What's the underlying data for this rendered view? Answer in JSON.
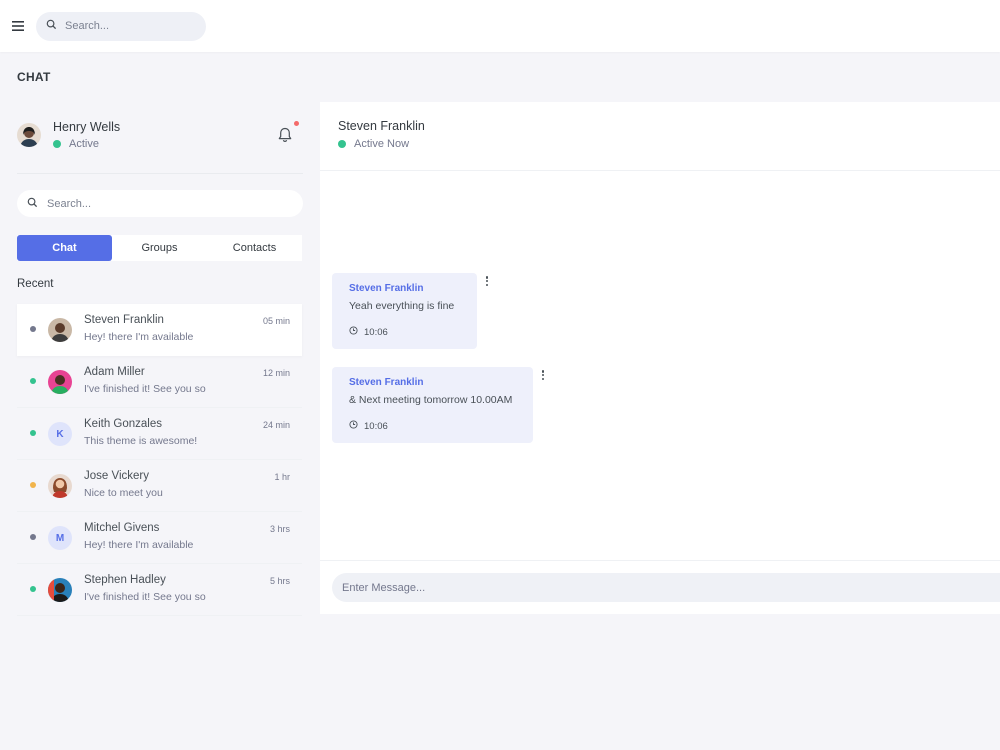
{
  "topbar": {
    "search_placeholder": "Search..."
  },
  "page_title": "CHAT",
  "current_user": {
    "name": "Henry Wells",
    "status": "Active",
    "status_color": "#34c38f"
  },
  "sidebar": {
    "search_placeholder": "Search...",
    "tabs": [
      {
        "label": "Chat",
        "active": true
      },
      {
        "label": "Groups",
        "active": false
      },
      {
        "label": "Contacts",
        "active": false
      }
    ],
    "recent_title": "Recent",
    "conversations": [
      {
        "name": "Steven Franklin",
        "message": "Hey! there I'm available",
        "time": "05 min",
        "status_color": "#74788d",
        "avatar": "photo"
      },
      {
        "name": "Adam Miller",
        "message": "I've finished it! See you so",
        "time": "12 min",
        "status_color": "#34c38f",
        "avatar": "photo"
      },
      {
        "name": "Keith Gonzales",
        "message": "This theme is awesome!",
        "time": "24 min",
        "status_color": "#34c38f",
        "avatar_letter": "K"
      },
      {
        "name": "Jose Vickery",
        "message": "Nice to meet you",
        "time": "1 hr",
        "status_color": "#f1b44c",
        "avatar": "photo"
      },
      {
        "name": "Mitchel Givens",
        "message": "Hey! there I'm available",
        "time": "3 hrs",
        "status_color": "#74788d",
        "avatar_letter": "M"
      },
      {
        "name": "Stephen Hadley",
        "message": "I've finished it! See you so",
        "time": "5 hrs",
        "status_color": "#34c38f",
        "avatar": "photo"
      }
    ]
  },
  "chat": {
    "contact_name": "Steven Franklin",
    "contact_status": "Active Now",
    "status_color": "#34c38f",
    "messages": [
      {
        "sender": "Steven Franklin",
        "text": "Yeah everything is fine",
        "time": "10:06"
      },
      {
        "sender": "Steven Franklin",
        "text": "& Next meeting tomorrow 10.00AM",
        "time": "10:06"
      }
    ],
    "composer_placeholder": "Enter Message..."
  },
  "colors": {
    "primary": "#556ee6",
    "notification": "#f46a6a"
  }
}
